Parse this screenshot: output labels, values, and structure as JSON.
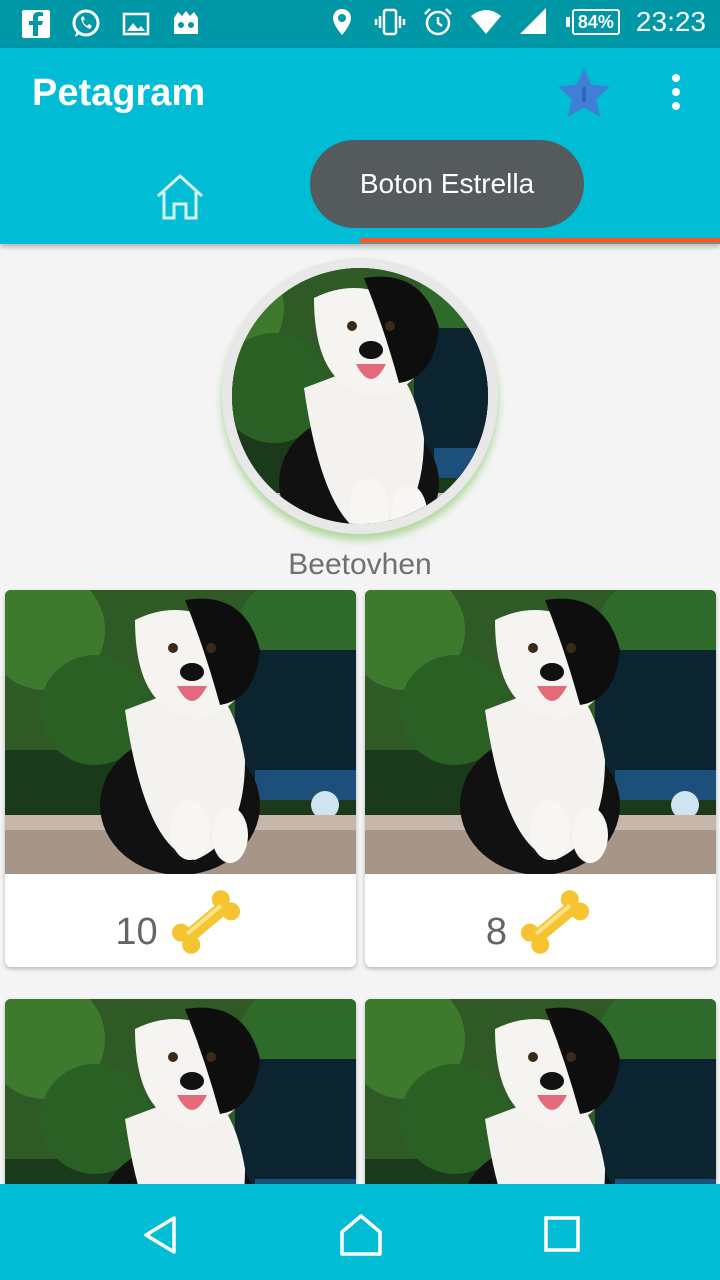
{
  "status_bar": {
    "battery": "84%",
    "time": "23:23"
  },
  "app": {
    "title": "Petagram"
  },
  "toast": {
    "text": "Boton Estrella"
  },
  "profile": {
    "name": "Beetovhen"
  },
  "pets": [
    {
      "likes": "10"
    },
    {
      "likes": "8"
    },
    {
      "likes": ""
    },
    {
      "likes": ""
    }
  ],
  "colors": {
    "primary": "#00bcd4",
    "primary_dark": "#0097a7",
    "accent": "#ff5722",
    "star": "#3f7fd6",
    "bone": "#f6c431"
  },
  "icons": [
    "facebook-icon",
    "whatsapp-icon",
    "gallery-icon",
    "game-icon",
    "location-icon",
    "vibrate-icon",
    "alarm-icon",
    "wifi-icon",
    "signal-icon",
    "battery-icon",
    "star-icon",
    "more-vert-icon",
    "home-icon",
    "dog-icon",
    "bone-icon",
    "back-icon",
    "home-nav-icon",
    "recents-icon"
  ]
}
